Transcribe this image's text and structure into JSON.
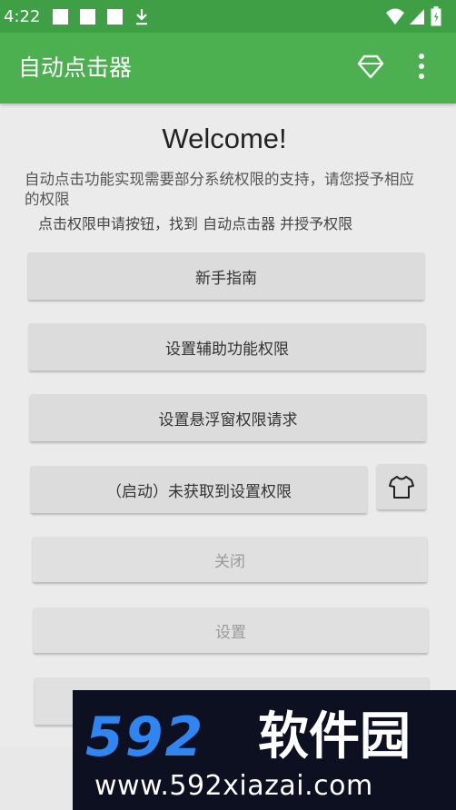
{
  "status_bar": {
    "time": "4:22",
    "notification_icons": [
      "notification-square-icon",
      "notification-square-icon",
      "notification-square-icon",
      "download-icon"
    ],
    "right_icons": [
      "wifi-icon",
      "signal-icon",
      "battery-icon"
    ],
    "bg_color": "#3f9f45"
  },
  "app_bar": {
    "title": "自动点击器",
    "actions": [
      "diamond-icon",
      "more-vert-icon"
    ],
    "bg_color": "#4caf50"
  },
  "content": {
    "welcome": "Welcome!",
    "description": "自动点击功能实现需要部分系统权限的支持，请您授予相应的权限",
    "hint": "点击权限申请按钮，找到 自动点击器 并授予权限",
    "buttons": {
      "guide": "新手指南",
      "accessibility": "设置辅助功能权限",
      "overlay": "设置悬浮窗权限请求",
      "start": "（启动）未获取到设置权限",
      "close": "关闭",
      "settings": "设置"
    },
    "theme_icon": "tshirt-icon"
  },
  "watermark": {
    "number": "592",
    "brand": "软件园",
    "url": "www.592xiazai.com"
  }
}
